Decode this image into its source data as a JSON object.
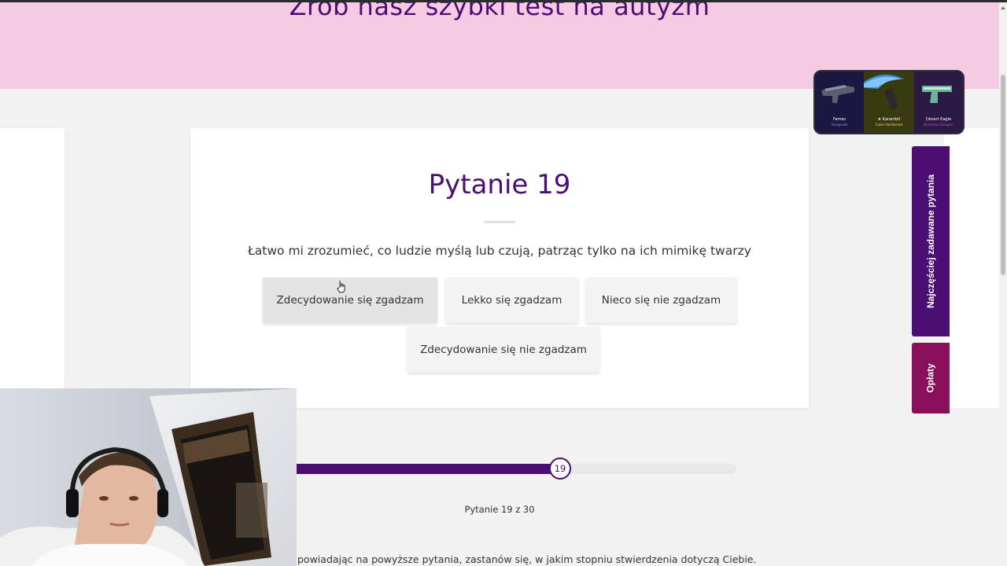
{
  "hero": {
    "title": "Zrób nasz szybki test na autyzm"
  },
  "question": {
    "title": "Pytanie 19",
    "text": "Łatwo mi zrozumieć, co ludzie myślą lub czują, patrząc tylko na ich mimikę twarzy"
  },
  "answers": [
    "Zdecydowanie się zgadzam",
    "Lekko się zgadzam",
    "Nieco się nie zgadzam",
    "Zdecydowanie się nie zgadzam"
  ],
  "progress": {
    "current": "19",
    "total": 30,
    "fraction": 0.6,
    "label": "Pytanie 19 z 30"
  },
  "footer": {
    "text": "powiadając na powyższe pytania, zastanów się, w jakim stopniu stwierdzenia dotyczą Ciebie."
  },
  "side_tabs": {
    "faq": "Najczęściej zadawane pytania",
    "fees": "Opłaty"
  },
  "ad": {
    "items": [
      {
        "name": "Fames",
        "sub": "Sergeant"
      },
      {
        "name": "★ Karambit",
        "sub": "Case Hardened"
      },
      {
        "name": "Desert Eagle",
        "sub": "Kumicho Dragon"
      }
    ]
  },
  "colors": {
    "brand_purple": "#4b0f73",
    "hero_pink": "#f4cbe3",
    "faq_tab": "#4b0f73",
    "fees_tab": "#8a0f5a"
  }
}
